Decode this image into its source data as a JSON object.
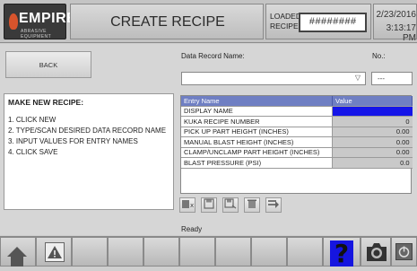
{
  "header": {
    "logo_text": "EMPIRE",
    "logo_subtext": "ABRASIVE EQUIPMENT",
    "title": "CREATE RECIPE",
    "loaded_recipe_label": "LOADED RECIPE",
    "loaded_recipe_value": "########",
    "date": "2/23/2016",
    "time": "3:13:17 PM"
  },
  "back_button": {
    "label": "BACK"
  },
  "instructions": {
    "heading": "MAKE NEW RECIPE:",
    "steps": [
      "1. CLICK NEW",
      "2. TYPE/SCAN DESIRED DATA RECORD NAME",
      "3. INPUT VALUES FOR ENTRY NAMES",
      "4. CLICK SAVE"
    ]
  },
  "data_record": {
    "label": "Data Record Name:",
    "value": ""
  },
  "number": {
    "label": "No.:",
    "value": "---"
  },
  "grid": {
    "columns": [
      "Entry Name",
      "Value"
    ],
    "rows": [
      {
        "name": "DISPLAY NAME",
        "value": ""
      },
      {
        "name": "KUKA RECIPE NUMBER",
        "value": "0"
      },
      {
        "name": "PICK UP PART HEIGHT (INCHES)",
        "value": "0.00"
      },
      {
        "name": "MANUAL BLAST HEIGHT (INCHES)",
        "value": "0.00"
      },
      {
        "name": "CLAMP/UNCLAMP PART HEIGHT (INCHES)",
        "value": "0.00"
      },
      {
        "name": "BLAST PRESSURE (PSI)",
        "value": "0.0"
      }
    ]
  },
  "toolbar": {
    "icons": [
      "new-record-icon",
      "save-icon",
      "save-as-icon",
      "delete-icon",
      "export-icon"
    ]
  },
  "status_text": "Ready",
  "footer": {
    "icons": [
      "home-icon",
      "warning-icon",
      "help-icon",
      "camera-icon",
      "power-icon"
    ]
  },
  "colors": {
    "header_bar": "#6f7fc3",
    "selection": "#1515e8",
    "logo_flame": "#d8542c"
  }
}
